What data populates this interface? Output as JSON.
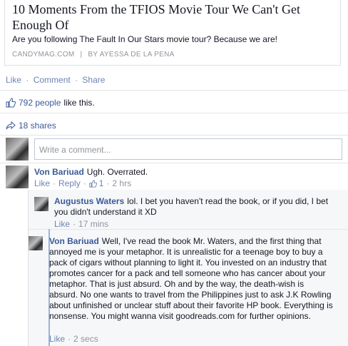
{
  "story": {
    "title": "10 Moments From the TFIOS Movie Tour We Can't Get Enough Of",
    "description": "Are you following The Fault In Our Stars movie tour? Because we are!",
    "source": "CANDYMAG.COM",
    "separator": "|",
    "byline": "BY AYESSA DE LA PENA"
  },
  "actions": {
    "like": "Like",
    "comment": "Comment",
    "share": "Share",
    "dot": "·"
  },
  "likes": {
    "count": "792 people",
    "suffix": "like this.",
    "icon": "thumbs-up-icon"
  },
  "shares": {
    "count": "18 shares",
    "icon": "share-arrow-icon"
  },
  "composer": {
    "placeholder": "Write a comment..."
  },
  "comments": [
    {
      "author": "Von Bariuad",
      "text": "Ugh. Overrated.",
      "like": "Like",
      "reply": "Reply",
      "like_count": "1",
      "time": "2 hrs"
    }
  ],
  "replies": [
    {
      "author": "Augustus Waters",
      "text": "lol. I bet you haven't read the book, or if you did, I bet you didn't understand it XD",
      "like": "Like",
      "time": "17 mins"
    },
    {
      "author": "Von Bariuad",
      "text": "Well, I've read the book Mr. Waters, and the first thing that annoyed me is your metaphor. It is unrealistic for a teenage boy to buy a pack of cigars without planning to light it. You invested on an industry that promotes cancer for a pack and tell someone who has cancer about your metaphor. That is just absurd. Oh and by the way, the death-wish is absurd. No one wants to travel from the Philippines just to ask J.K Rowling about unfinished or unclear stuff about their favorite HP book. Everything is nonsense. You might wanna visit goodreads.com for further opinions.",
      "like": "Like",
      "time": "2 secs"
    }
  ],
  "colors": {
    "link": "#3b5998",
    "muted": "#90949c",
    "action": "#6d84b4",
    "reply_bar": "#9cb4d8"
  }
}
